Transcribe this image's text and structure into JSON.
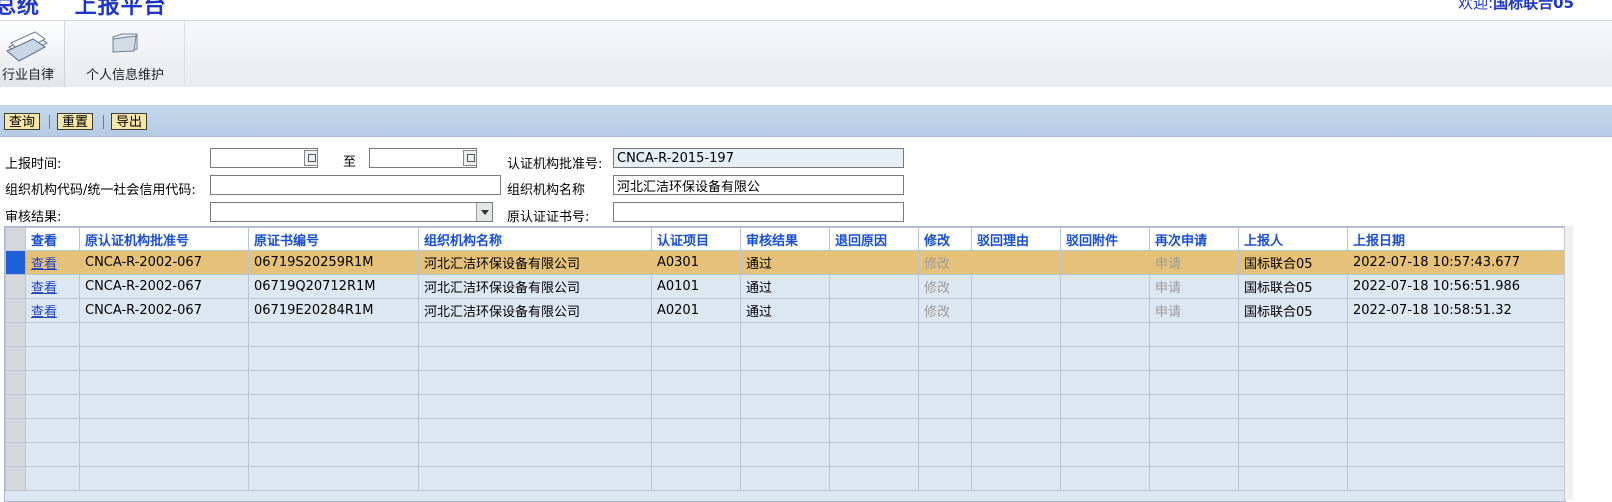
{
  "header": {
    "system_title": "总统    上报平台",
    "welcome_prefix": "欢迎:",
    "welcome_user": "国标联合05"
  },
  "nav": {
    "items": [
      {
        "label": "行业自律",
        "icon": "documents-icon"
      },
      {
        "label": "个人信息维护",
        "icon": "folder-icon"
      }
    ]
  },
  "toolbar": {
    "query_label": "查询",
    "reset_label": "重置",
    "export_label": "导出"
  },
  "form": {
    "report_time_label": "上报时间:",
    "report_time_from": "",
    "to_label": "至",
    "report_time_to": "",
    "approval_no_label": "认证机构批准号:",
    "approval_no_value": "CNCA-R-2015-197",
    "org_code_label": "组织机构代码/统一社会信用代码:",
    "org_code_value": "",
    "org_name_label": "组织机构名称",
    "org_name_value": "河北汇洁环保设备有限公",
    "review_result_label": "审核结果:",
    "review_result_value": "",
    "orig_cert_no_label": "原认证证书号:",
    "orig_cert_no_value": ""
  },
  "grid": {
    "columns": [
      "查看",
      "原认证机构批准号",
      "原证书编号",
      "组织机构名称",
      "认证项目",
      "审核结果",
      "退回原因",
      "修改",
      "驳回理由",
      "驳回附件",
      "再次申请",
      "上报人",
      "上报日期"
    ],
    "rows": [
      {
        "view": "查看",
        "approval_no": "CNCA-R-2002-067",
        "cert_no": "06719S20259R1M",
        "org_name": "河北汇洁环保设备有限公司",
        "project": "A0301",
        "result": "通过",
        "return_reason": "",
        "modify": "修改",
        "reject_reason": "",
        "reject_attachment": "",
        "reapply": "申请",
        "reporter": "国标联合05",
        "report_date": "2022-07-18 10:57:43.677"
      },
      {
        "view": "查看",
        "approval_no": "CNCA-R-2002-067",
        "cert_no": "06719Q20712R1M",
        "org_name": "河北汇洁环保设备有限公司",
        "project": "A0101",
        "result": "通过",
        "return_reason": "",
        "modify": "修改",
        "reject_reason": "",
        "reject_attachment": "",
        "reapply": "申请",
        "reporter": "国标联合05",
        "report_date": "2022-07-18 10:56:51.986"
      },
      {
        "view": "查看",
        "approval_no": "CNCA-R-2002-067",
        "cert_no": "06719E20284R1M",
        "org_name": "河北汇洁环保设备有限公司",
        "project": "A0201",
        "result": "通过",
        "return_reason": "",
        "modify": "修改",
        "reject_reason": "",
        "reject_attachment": "",
        "reapply": "申请",
        "reporter": "国标联合05",
        "report_date": "2022-07-18 10:58:51.32"
      }
    ],
    "selected_row": 0
  },
  "colors": {
    "header_text": "#1f37c8",
    "column_header_text": "#1a4fd1",
    "selected_row": "#e6c17a",
    "grid_background": "#dce7f2",
    "toolbar_button": "#f6e6a7"
  }
}
